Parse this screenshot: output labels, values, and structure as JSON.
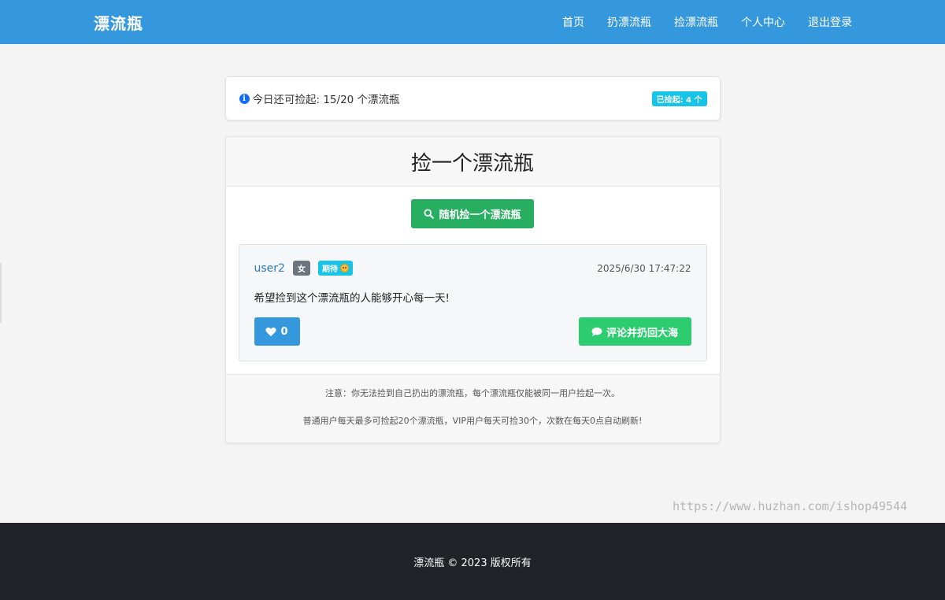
{
  "navbar": {
    "brand": "漂流瓶",
    "links": [
      "首页",
      "扔漂流瓶",
      "捡漂流瓶",
      "个人中心",
      "退出登录"
    ]
  },
  "quota": {
    "text": "今日还可捡起: 15/20 个漂流瓶",
    "badge": "已捡起: 4 个"
  },
  "card": {
    "title": "捡一个漂流瓶",
    "pick_button": "随机捡一个漂流瓶"
  },
  "bottle": {
    "username": "user2",
    "gender": "女",
    "mood": "期待",
    "timestamp": "2025/6/30 17:47:22",
    "content": "希望捡到这个漂流瓶的人能够开心每一天!",
    "likes": "0",
    "comment_button": "评论并扔回大海"
  },
  "notes": [
    "注意：你无法捡到自己扔出的漂流瓶，每个漂流瓶仅能被同一用户捡起一次。",
    "普通用户每天最多可捡起20个漂流瓶，VIP用户每天可捡30个，次数在每天0点自动刷新!"
  ],
  "footer": {
    "text": "漂流瓶 © 2023 版权所有"
  },
  "watermark": "https://www.huzhan.com/ishop49544",
  "colors": {
    "navbar": "#3598dc",
    "pick_button": "#27ae60",
    "comment_button": "#2ecc71",
    "like_button": "#3598dc",
    "badge_info": "#17c3e6",
    "footer": "#202328"
  },
  "icons": {
    "quota": "info-circle-icon",
    "pick": "search-icon",
    "like": "heart-icon",
    "comment": "comment-icon",
    "mood": "star-struck-face-icon"
  }
}
